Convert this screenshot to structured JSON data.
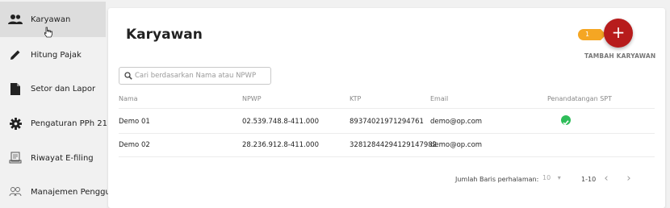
{
  "sidebar": {
    "items": [
      {
        "label": "Karyawan",
        "icon": "people-icon",
        "active": true
      },
      {
        "label": "Hitung Pajak",
        "icon": "pencil-icon",
        "active": false
      },
      {
        "label": "Setor dan Lapor",
        "icon": "document-icon",
        "active": false
      },
      {
        "label": "Pengaturan PPh 21",
        "icon": "gear-icon",
        "active": false
      },
      {
        "label": "Riwayat E-filing",
        "icon": "efiling-icon",
        "active": false
      },
      {
        "label": "Manajemen Pengguna",
        "icon": "users-manage-icon",
        "active": false
      }
    ]
  },
  "main": {
    "title": "Karyawan",
    "add_button": {
      "icon": "+",
      "badge": "1",
      "label": "TAMBAH KARYAWAN",
      "color": "#b71c1c",
      "badge_color": "#f5a623"
    },
    "search": {
      "placeholder": "Cari berdasarkan Nama atau NPWP",
      "value": ""
    },
    "table": {
      "columns": [
        "Nama",
        "NPWP",
        "KTP",
        "Email",
        "Penandatangan SPT"
      ],
      "rows": [
        {
          "nama": "Demo 01",
          "npwp": "02.539.748.8-411.000",
          "ktp": "89374021971294761",
          "email": "demo@op.com",
          "penandatangan": true
        },
        {
          "nama": "Demo 02",
          "npwp": "28.236.912.8-411.000",
          "ktp": "32812844294129147982",
          "email": "demo@op.com",
          "penandatangan": false
        }
      ]
    },
    "pagination": {
      "rows_label": "Jumlah Baris perhalaman:",
      "rows_per_page": "10",
      "range": "1-10",
      "prev": "‹",
      "next": "›"
    }
  }
}
